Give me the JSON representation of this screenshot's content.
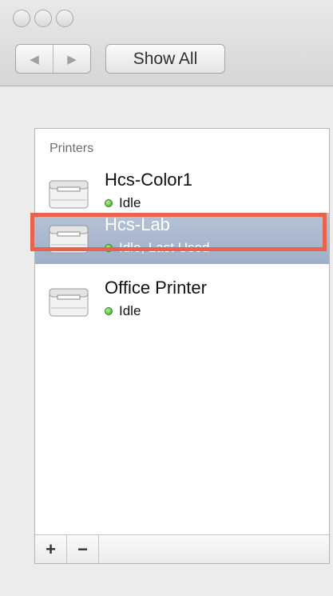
{
  "toolbar": {
    "back_icon": "◀",
    "forward_icon": "▶",
    "show_all_label": "Show All"
  },
  "printers": {
    "heading": "Printers",
    "items": [
      {
        "name": "Hcs-Color1",
        "status": "Idle",
        "selected": false
      },
      {
        "name": "Hcs-Lab",
        "status": "Idle, Last Used",
        "selected": true
      },
      {
        "name": "Office Printer",
        "status": "Idle",
        "selected": false
      }
    ],
    "add_label": "+",
    "remove_label": "−"
  },
  "colors": {
    "selection": "#9eafc9",
    "highlight_border": "#e9624e",
    "status_dot": "#3fa52a"
  }
}
